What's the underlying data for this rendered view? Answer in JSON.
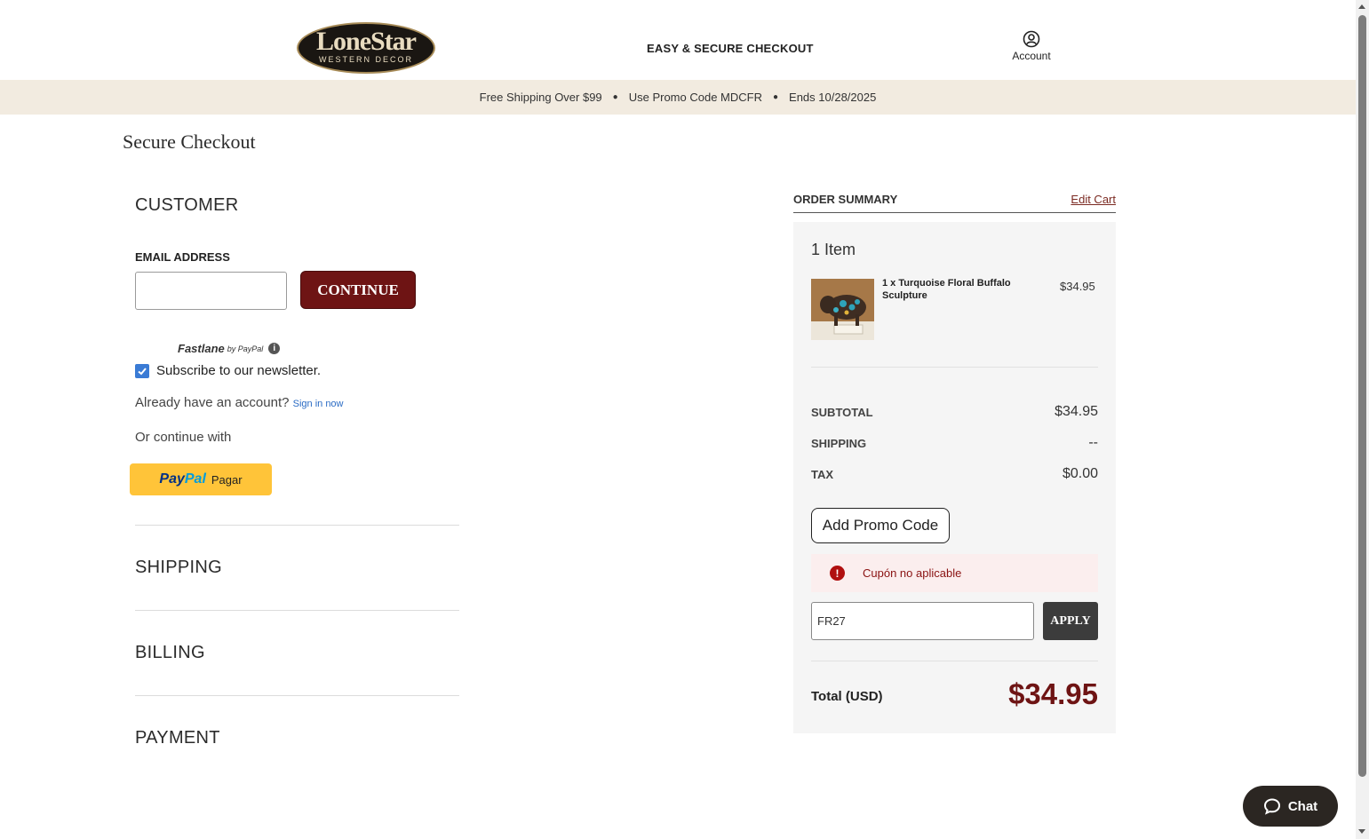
{
  "header": {
    "logo_text": "LoneStar",
    "logo_subtext": "WESTERN DECOR",
    "center_text": "EASY & SECURE CHECKOUT",
    "account_label": "Account"
  },
  "promo_bar": {
    "shipping": "Free Shipping Over $99",
    "code": "Use Promo Code MDCFR",
    "ends": "Ends 10/28/2025"
  },
  "page": {
    "title": "Secure Checkout"
  },
  "customer": {
    "title": "CUSTOMER",
    "email_label": "EMAIL ADDRESS",
    "email_value": "",
    "continue_label": "CONTINUE",
    "fastlane": "Fastlane",
    "fastlane_by": "by PayPal",
    "newsletter_label": "Subscribe to our newsletter.",
    "newsletter_checked": true,
    "already_text": "Already have an account?",
    "signin_label": "Sign in now",
    "or_continue": "Or continue with",
    "paypal_pay": "Pay",
    "paypal_pal": "Pal",
    "paypal_pagar": "Pagar"
  },
  "sections": {
    "shipping": "SHIPPING",
    "billing": "BILLING",
    "payment": "PAYMENT"
  },
  "summary": {
    "title": "ORDER SUMMARY",
    "edit_cart": "Edit Cart",
    "items_count": "1 Item",
    "product": {
      "name": "1 x Turquoise Floral Buffalo Sculpture",
      "price": "$34.95"
    },
    "subtotal_label": "SUBTOTAL",
    "subtotal_value": "$34.95",
    "shipping_label": "SHIPPING",
    "shipping_value": "--",
    "tax_label": "TAX",
    "tax_value": "$0.00",
    "add_promo_label": "Add Promo Code",
    "error_message": "Cupón no aplicable",
    "promo_input_value": "FR27",
    "apply_label": "APPLY",
    "total_label": "Total (USD)",
    "total_value": "$34.95"
  },
  "chat": {
    "label": "Chat"
  },
  "colors": {
    "brand": "#6e1414",
    "promo_bar_bg": "#f2ebe0",
    "summary_bg": "#f5f5f5",
    "paypal_yellow": "#ffc439",
    "checkbox_blue": "#3a7bd5",
    "error_bg": "#fbeeee"
  }
}
